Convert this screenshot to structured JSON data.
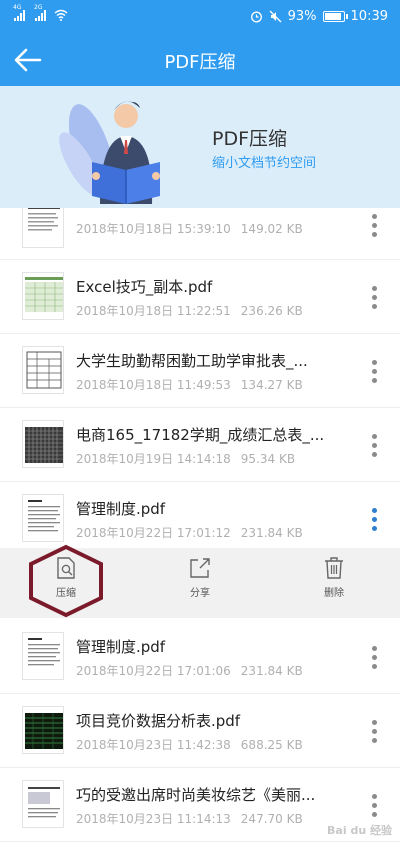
{
  "status_bar": {
    "sim1_label": "4G",
    "sim2_label": "2G",
    "battery": "93%",
    "time": "10:39"
  },
  "header": {
    "title": "PDF压缩"
  },
  "banner": {
    "title": "PDF压缩",
    "subtitle": "缩小文档节约空间"
  },
  "files": [
    {
      "name": "",
      "date": "2018年10月18日 15:39:10",
      "size": "149.02 KB",
      "thumb": "doc"
    },
    {
      "name": "Excel技巧_副本.pdf",
      "date": "2018年10月18日 11:22:51",
      "size": "236.26 KB",
      "thumb": "sheet"
    },
    {
      "name": "大学生助勤帮困勤工助学审批表_...",
      "date": "2018年10月18日 11:49:53",
      "size": "134.27 KB",
      "thumb": "form"
    },
    {
      "name": "电商165_17182学期_成绩汇总表_...",
      "date": "2018年10月19日 14:14:18",
      "size": "95.34 KB",
      "thumb": "grid"
    },
    {
      "name": "管理制度.pdf",
      "date": "2018年10月22日 17:01:12",
      "size": "231.84 KB",
      "thumb": "doc"
    },
    {
      "name": "管理制度.pdf",
      "date": "2018年10月22日 17:01:06",
      "size": "231.84 KB",
      "thumb": "doc"
    },
    {
      "name": "项目竞价数据分析表.pdf",
      "date": "2018年10月23日 11:42:38",
      "size": "688.25 KB",
      "thumb": "dark"
    },
    {
      "name": "巧的受邀出席时尚美妆综艺《美丽...",
      "date": "2018年10月23日 11:14:13",
      "size": "247.70 KB",
      "thumb": "doc"
    }
  ],
  "actions": {
    "compress": "压缩",
    "share": "分享",
    "delete": "删除"
  },
  "watermark": "Bai du 经验",
  "icons": {
    "back": "arrow-left-icon",
    "more": "more-vertical-icon",
    "compress": "document-search-icon",
    "share": "share-icon",
    "delete": "trash-icon"
  },
  "colors": {
    "primary": "#2f9cf0",
    "banner_bg": "#dcedfa",
    "highlight": "#7a1a2a"
  }
}
